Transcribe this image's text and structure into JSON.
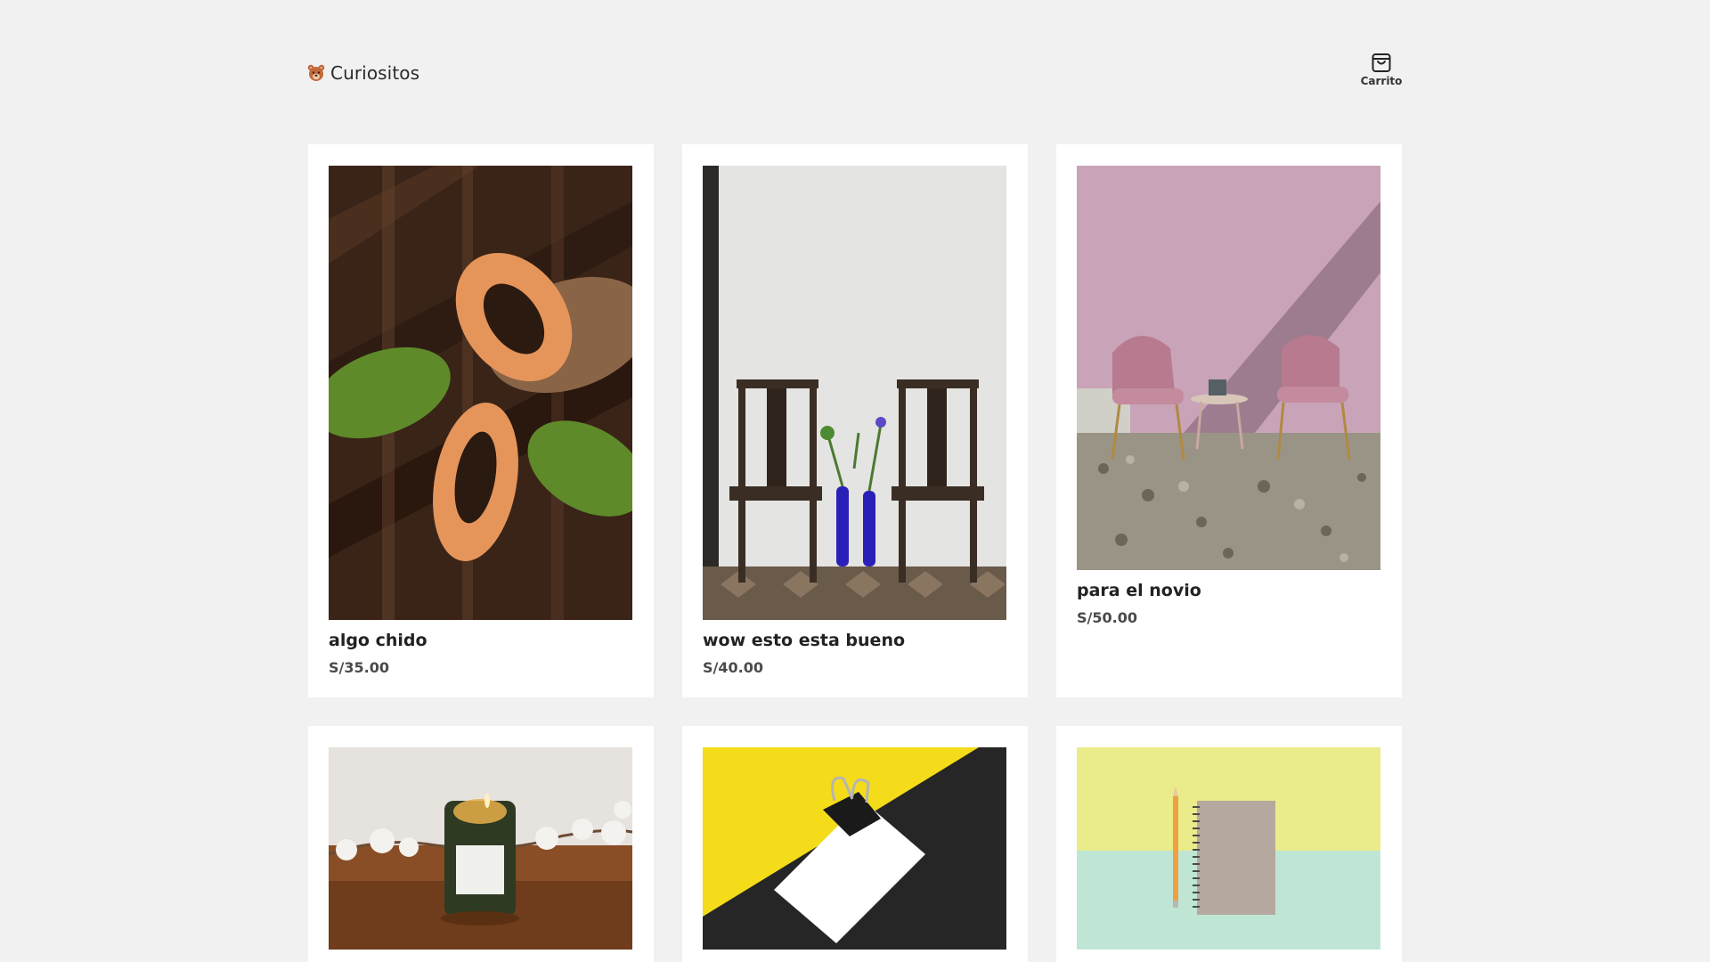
{
  "header": {
    "brand_name": "Curiositos",
    "brand_logo": "bear-face-icon",
    "cart_label": "Carrito",
    "cart_icon": "shopping-bag-icon"
  },
  "products": [
    {
      "name": "algo chido",
      "price": "S/35.00",
      "image": "papaya-photo"
    },
    {
      "name": "wow esto esta bueno",
      "price": "S/40.00",
      "image": "chairs-vases-photo"
    },
    {
      "name": "para el novio",
      "price": "S/50.00",
      "image": "pink-chairs-photo"
    },
    {
      "name": "",
      "price": "",
      "image": "candle-photo"
    },
    {
      "name": "",
      "price": "",
      "image": "binder-clip-photo"
    },
    {
      "name": "",
      "price": "",
      "image": "notebook-pencil-photo"
    }
  ],
  "colors": {
    "background": "#f1f1f1",
    "card": "#ffffff",
    "text": "#222222"
  }
}
